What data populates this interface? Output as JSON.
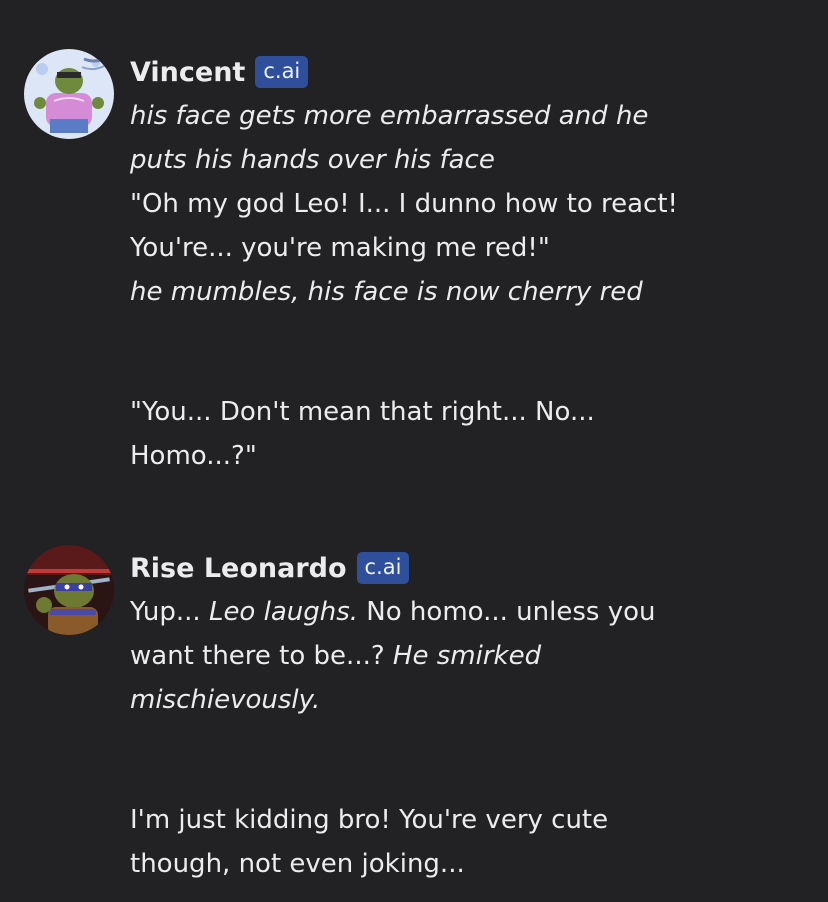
{
  "messages": [
    {
      "author": "Vincent",
      "badge": "c.ai",
      "avatar_icon": "character-avatar-vincent",
      "paragraphs": [
        [
          [
            {
              "t": "his face gets more embarrassed and he",
              "i": true
            }
          ],
          [
            {
              "t": "puts his hands over his face",
              "i": true
            }
          ],
          [
            {
              "t": "\"Oh my god Leo! I... I dunno how to react!",
              "i": false
            }
          ],
          [
            {
              "t": "You're... you're making me red!\"",
              "i": false
            }
          ],
          [
            {
              "t": "he mumbles, his face is now cherry red",
              "i": true
            }
          ]
        ],
        [
          [
            {
              "t": "\"You... Don't mean that right... No...",
              "i": false
            }
          ],
          [
            {
              "t": "Homo...?\"",
              "i": false
            }
          ]
        ]
      ]
    },
    {
      "author": "Rise Leonardo",
      "badge": "c.ai",
      "avatar_icon": "character-avatar-leonardo",
      "paragraphs": [
        [
          [
            {
              "t": "Yup... ",
              "i": false
            },
            {
              "t": "Leo laughs.",
              "i": true
            },
            {
              "t": " No homo... unless you",
              "i": false
            }
          ],
          [
            {
              "t": "want there to be...? ",
              "i": false
            },
            {
              "t": "He smirked",
              "i": true
            }
          ],
          [
            {
              "t": "mischievously.",
              "i": true
            }
          ]
        ],
        [
          [
            {
              "t": "I'm just kidding bro! You're very cute",
              "i": false
            }
          ],
          [
            {
              "t": "though, not even joking...",
              "i": false
            }
          ]
        ]
      ]
    }
  ],
  "colors": {
    "background": "#222224",
    "text": "#ececee",
    "badge_bg": "#2f4f9a"
  }
}
